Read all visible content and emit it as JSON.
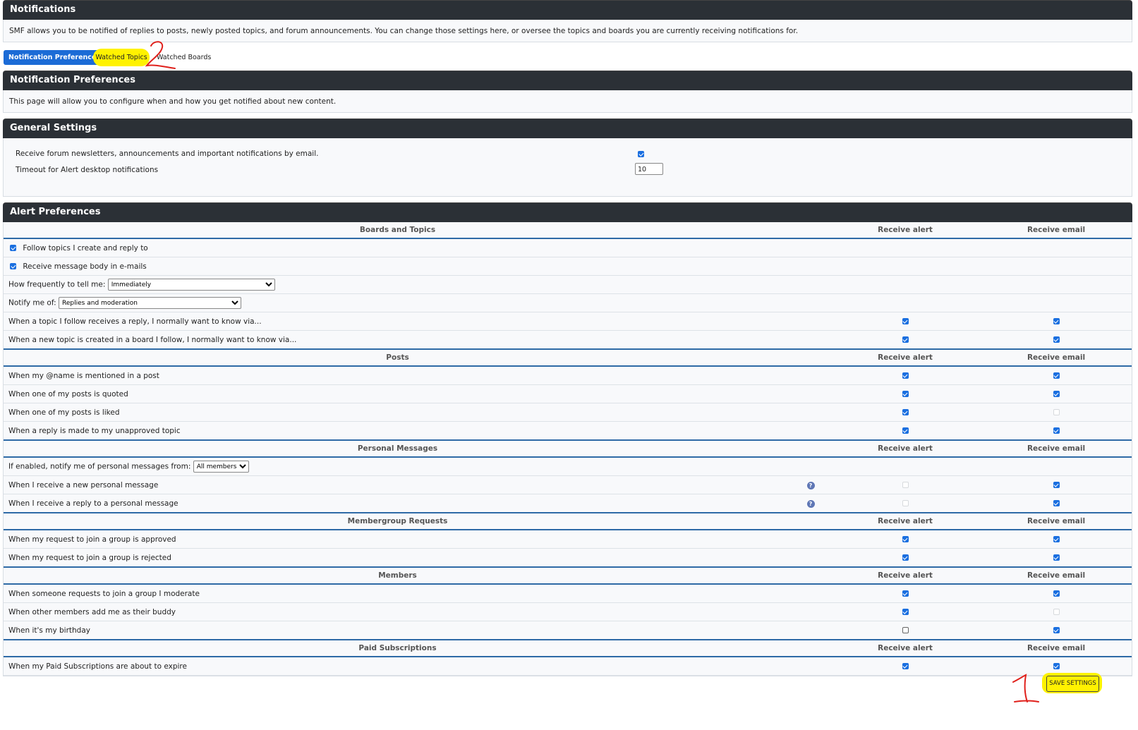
{
  "notifications": {
    "title": "Notifications",
    "description": "SMF allows you to be notified of replies to posts, newly posted topics, and forum announcements. You can change those settings here, or oversee the topics and boards you are currently receiving notifications for."
  },
  "tabs": [
    {
      "label": "Notification Preferences",
      "active": true
    },
    {
      "label": "Watched Topics",
      "highlighted": true
    },
    {
      "label": "Watched Boards"
    }
  ],
  "prefs": {
    "title": "Notification Preferences",
    "description": "This page will allow you to configure when and how you get notified about new content."
  },
  "general": {
    "title": "General Settings",
    "newsletter_label": "Receive forum newsletters, announcements and important notifications by email.",
    "newsletter_checked": true,
    "timeout_label": "Timeout for Alert desktop notifications",
    "timeout_value": "10"
  },
  "alerts": {
    "title": "Alert Preferences",
    "col_alert": "Receive alert",
    "col_email": "Receive email",
    "boards": {
      "heading": "Boards and Topics",
      "follow_label": "Follow topics I create and reply to",
      "body_label": "Receive message body in e-mails",
      "freq_label": "How frequently to tell me:",
      "freq_value": "Immediately",
      "notify_label": "Notify me of:",
      "notify_value": "Replies and moderation",
      "rows": [
        {
          "label": "When a topic I follow receives a reply, I normally want to know via...",
          "alert": "on",
          "email": "on"
        },
        {
          "label": "When a new topic is created in a board I follow, I normally want to know via...",
          "alert": "on",
          "email": "on"
        }
      ]
    },
    "posts": {
      "heading": "Posts",
      "rows": [
        {
          "label": "When my @name is mentioned in a post",
          "alert": "on",
          "email": "on"
        },
        {
          "label": "When one of my posts is quoted",
          "alert": "on",
          "email": "on"
        },
        {
          "label": "When one of my posts is liked",
          "alert": "on",
          "email": "disabled"
        },
        {
          "label": "When a reply is made to my unapproved topic",
          "alert": "on",
          "email": "on"
        }
      ]
    },
    "pm": {
      "heading": "Personal Messages",
      "from_label": "If enabled, notify me of personal messages from:",
      "from_value": "All members",
      "rows": [
        {
          "label": "When I receive a new personal message",
          "alert": "disabled",
          "email": "on",
          "help": "?"
        },
        {
          "label": "When I receive a reply to a personal message",
          "alert": "disabled",
          "email": "on",
          "help": "?"
        }
      ]
    },
    "groups": {
      "heading": "Membergroup Requests",
      "rows": [
        {
          "label": "When my request to join a group is approved",
          "alert": "on",
          "email": "on"
        },
        {
          "label": "When my request to join a group is rejected",
          "alert": "on",
          "email": "on"
        }
      ]
    },
    "members": {
      "heading": "Members",
      "rows": [
        {
          "label": "When someone requests to join a group I moderate",
          "alert": "on",
          "email": "on"
        },
        {
          "label": "When other members add me as their buddy",
          "alert": "on",
          "email": "disabled"
        },
        {
          "label": "When it's my birthday",
          "alert": "off",
          "email": "on"
        }
      ]
    },
    "paid": {
      "heading": "Paid Subscriptions",
      "rows": [
        {
          "label": "When my Paid Subscriptions are about to expire",
          "alert": "on",
          "email": "on"
        }
      ]
    }
  },
  "save_label": "SAVE SETTINGS",
  "annotations": {
    "one": "1",
    "two": "2"
  },
  "colors": {
    "header": "#2b3036",
    "accent": "#1b6bd6",
    "highlight": "#fff200",
    "annotation": "#e0211c"
  }
}
